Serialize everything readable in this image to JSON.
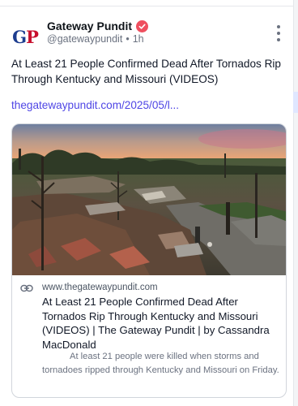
{
  "post": {
    "author_name": "Gateway Pundit",
    "author_handle": "@gatewaypundit",
    "separator": "•",
    "time": "1h",
    "avatar_text_g": "G",
    "avatar_text_p": "P",
    "text": "At Least 21 People Confirmed Dead After Tornados Rip Through Kentucky and Missouri (VIDEOS)",
    "link": "thegatewaypundit.com/2025/05/l..."
  },
  "card": {
    "domain": "www.thegatewaypundit.com",
    "title": "At Least 21 People Confirmed Dead After Tornados Rip Through Kentucky and Missouri (VIDEOS) | The Gateway Pundit | by Cassandra MacDonald",
    "description": "At least 21 people were killed when storms and tornadoes ripped through Kentucky and Missouri on Friday."
  },
  "icons": {
    "verified": "verified-badge-icon",
    "more": "more-options-icon",
    "link": "link-icon"
  },
  "colors": {
    "link": "#4f46e5",
    "verified": "#ef4f5f",
    "avatar_blue": "#1d3d8f",
    "avatar_red": "#c8102e"
  }
}
